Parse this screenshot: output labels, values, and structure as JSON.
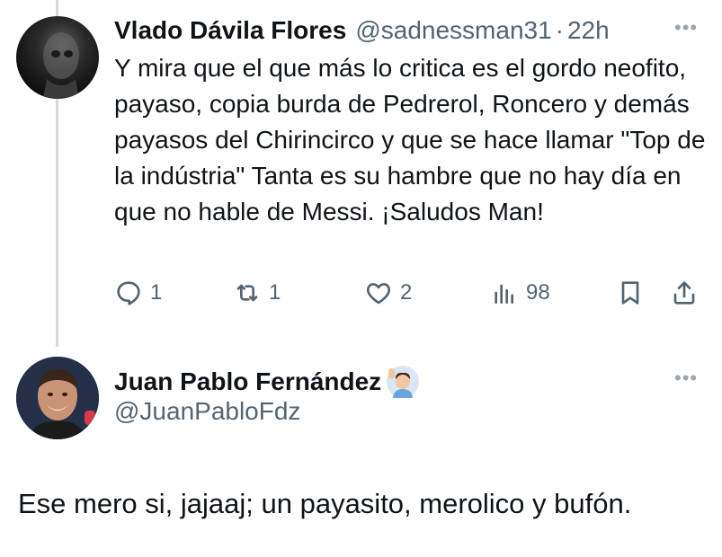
{
  "tweet1": {
    "author_name": "Vlado Dávila Flores",
    "handle": "@sadnessman31",
    "separator": "·",
    "time": "22h",
    "more_label": "•••",
    "text": "Y mira que el que más lo critica es el gordo neofito, payaso, copia burda de Pedrerol, Roncero y demás payasos del Chirincirco y que se hace llamar \"Top de la indústria\" Tanta es su hambre que no hay día en que no hable de Messi. ¡Saludos Man!",
    "actions": {
      "replies": "1",
      "retweets": "1",
      "likes": "2",
      "views": "98"
    },
    "icons": [
      "reply-icon",
      "retweet-icon",
      "like-icon",
      "views-icon",
      "bookmark-icon",
      "share-icon"
    ]
  },
  "tweet2": {
    "author_name": "Juan Pablo Fernández",
    "handle": "@JuanPabloFdz",
    "more_label": "•••",
    "text": "Ese mero si, jajaaj; un payasito, merolico y bufón."
  },
  "colors": {
    "text": "#0f1419",
    "secondary": "#536471",
    "thread_line": "#cfd9de",
    "background": "#ffffff"
  }
}
